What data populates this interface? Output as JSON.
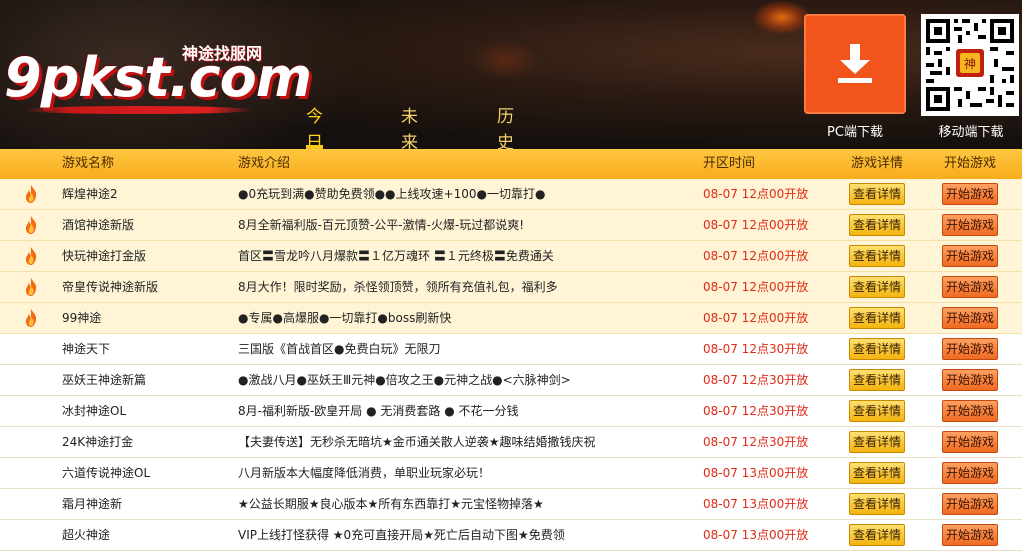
{
  "logo": {
    "main": "9pkst.com",
    "sub": "神途找服网"
  },
  "nav": {
    "tabs": [
      "今日开区",
      "未来开区",
      "历史开区"
    ],
    "active_index": 0
  },
  "downloads": {
    "pc_label": "PC端下载",
    "mobile_label": "移动端下载"
  },
  "colors": {
    "accent": "#f2551c",
    "header_bar": "#f7ad1c",
    "time_red": "#e02a16",
    "tab_gold": "#ffd21a"
  },
  "table": {
    "headers": {
      "name": "游戏名称",
      "desc": "游戏介绍",
      "time": "开区时间",
      "detail": "游戏详情",
      "play": "开始游戏"
    },
    "rows": [
      {
        "hot": true,
        "name": "辉煌神途2",
        "desc": "●0充玩到满●赞助免费领●●上线攻速+100●一切靠打●",
        "time": "08-07 12点00开放",
        "detail": "查看详情",
        "play": "开始游戏"
      },
      {
        "hot": true,
        "name": "酒馆神途新版",
        "desc": "8月全新福利版-百元顶赞-公平-激情-火爆-玩过都说爽!",
        "time": "08-07 12点00开放",
        "detail": "查看详情",
        "play": "开始游戏"
      },
      {
        "hot": true,
        "name": "快玩神途打金版",
        "desc": "首区〓雪龙吟八月爆款〓１亿万魂环 〓１元终极〓免费通关",
        "time": "08-07 12点00开放",
        "detail": "查看详情",
        "play": "开始游戏"
      },
      {
        "hot": true,
        "name": "帝皇传说神途新版",
        "desc": "8月大作！限时奖励，杀怪领顶赞，领所有充值礼包，福利多",
        "time": "08-07 12点00开放",
        "detail": "查看详情",
        "play": "开始游戏"
      },
      {
        "hot": true,
        "name": "99神途",
        "desc": "●专属●高爆服●一切靠打●boss刷新快",
        "time": "08-07 12点00开放",
        "detail": "查看详情",
        "play": "开始游戏"
      },
      {
        "hot": false,
        "name": "神途天下",
        "desc": "三国版《首战首区●免费白玩》无限刀",
        "time": "08-07 12点30开放",
        "detail": "查看详情",
        "play": "开始游戏"
      },
      {
        "hot": false,
        "name": "巫妖王神途新篇",
        "desc": "●激战八月●巫妖王Ⅲ元神●倍攻之王●元神之战●<六脉神剑>",
        "time": "08-07 12点30开放",
        "detail": "查看详情",
        "play": "开始游戏"
      },
      {
        "hot": false,
        "name": "冰封神途OL",
        "desc": "8月-福利新版-欧皇开局 ● 无消费套路 ● 不花一分钱",
        "time": "08-07 12点30开放",
        "detail": "查看详情",
        "play": "开始游戏"
      },
      {
        "hot": false,
        "name": "24K神途打金",
        "desc": "【夫妻传送】无秒杀无暗坑★金币通关散人逆袭★趣味结婚撒钱庆祝",
        "time": "08-07 12点30开放",
        "detail": "查看详情",
        "play": "开始游戏"
      },
      {
        "hot": false,
        "name": "六道传说神途OL",
        "desc": "八月新版本大幅度降低消费，单职业玩家必玩！",
        "time": "08-07 13点00开放",
        "detail": "查看详情",
        "play": "开始游戏"
      },
      {
        "hot": false,
        "name": "霜月神途新",
        "desc": "★公益长期服★良心版本★所有东西靠打★元宝怪物掉落★",
        "time": "08-07 13点00开放",
        "detail": "查看详情",
        "play": "开始游戏"
      },
      {
        "hot": false,
        "name": "超火神途",
        "desc": "VIP上线打怪获得 ★0充可直接开局★死亡后自动下图★免费领",
        "time": "08-07 13点00开放",
        "detail": "查看详情",
        "play": "开始游戏"
      }
    ]
  }
}
